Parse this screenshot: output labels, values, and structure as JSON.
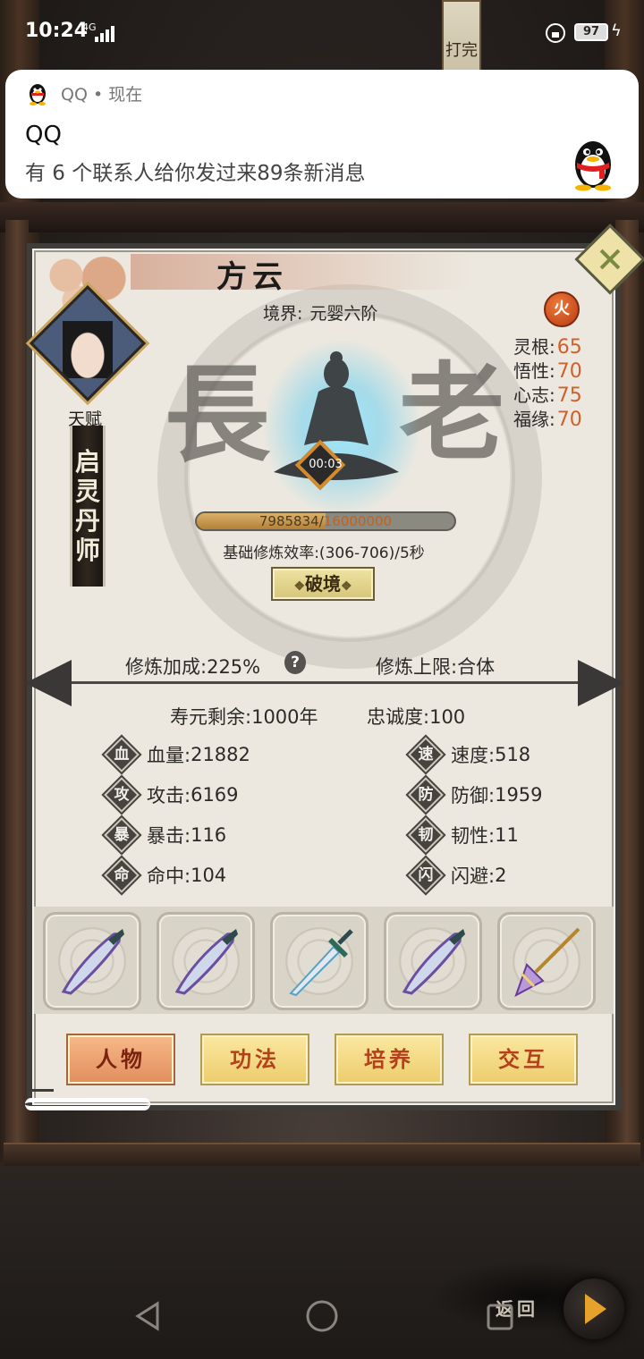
{
  "status_bar": {
    "time": "10:24",
    "network": "4G",
    "battery": "97"
  },
  "notification": {
    "app_name": "QQ",
    "time_label": "现在",
    "separator": "•",
    "title": "QQ",
    "body": "有 6 个联系人给你发过来89条新消息"
  },
  "background": {
    "banner_text": "打完",
    "back_label": "返回"
  },
  "character": {
    "name": "方云",
    "realm_label": "境界:",
    "realm_value": "元婴六阶",
    "talent_label": "天赋",
    "talent_chars": [
      "启",
      "灵",
      "丹",
      "师"
    ],
    "title_chars_left": "長",
    "title_chars_right": "老",
    "element": "火",
    "timer": "00:03",
    "stats": [
      {
        "label": "灵根:",
        "value": "65"
      },
      {
        "label": "悟性:",
        "value": "70"
      },
      {
        "label": "心志:",
        "value": "75"
      },
      {
        "label": "福缘:",
        "value": "70"
      }
    ],
    "xp_current": "7985834",
    "xp_separator": "/",
    "xp_max": "16000000",
    "xp_fraction": 0.499,
    "efficiency": "基础修炼效率:(306-706)/5秒",
    "break_button": "破境",
    "bonus_label": "修炼加成:",
    "bonus_value": "225%",
    "help": "?",
    "limit_label": "修炼上限:",
    "limit_value": "合体",
    "lifespan_label": "寿元剩余:",
    "lifespan_value": "1000年",
    "loyalty_label": "忠诚度:",
    "loyalty_value": "100",
    "attributes": [
      {
        "badge": "血",
        "label": "血量:",
        "value": "21882"
      },
      {
        "badge": "速",
        "label": "速度:",
        "value": "518"
      },
      {
        "badge": "攻",
        "label": "攻击:",
        "value": "6169"
      },
      {
        "badge": "防",
        "label": "防御:",
        "value": "1959"
      },
      {
        "badge": "暴",
        "label": "暴击:",
        "value": "116"
      },
      {
        "badge": "韧",
        "label": "韧性:",
        "value": "11"
      },
      {
        "badge": "命",
        "label": "命中:",
        "value": "104"
      },
      {
        "badge": "闪",
        "label": "闪避:",
        "value": "2"
      }
    ]
  },
  "equipment": [
    "blade-icon",
    "blade-icon",
    "sword-icon",
    "blade-icon",
    "spear-icon"
  ],
  "tabs": [
    {
      "label": "人物",
      "active": true
    },
    {
      "label": "功法",
      "active": false
    },
    {
      "label": "培养",
      "active": false
    },
    {
      "label": "交互",
      "active": false
    }
  ],
  "colors": {
    "stat_value": "#d0602a",
    "xp_max": "#c2621e",
    "tab_text": "#b5401c"
  }
}
